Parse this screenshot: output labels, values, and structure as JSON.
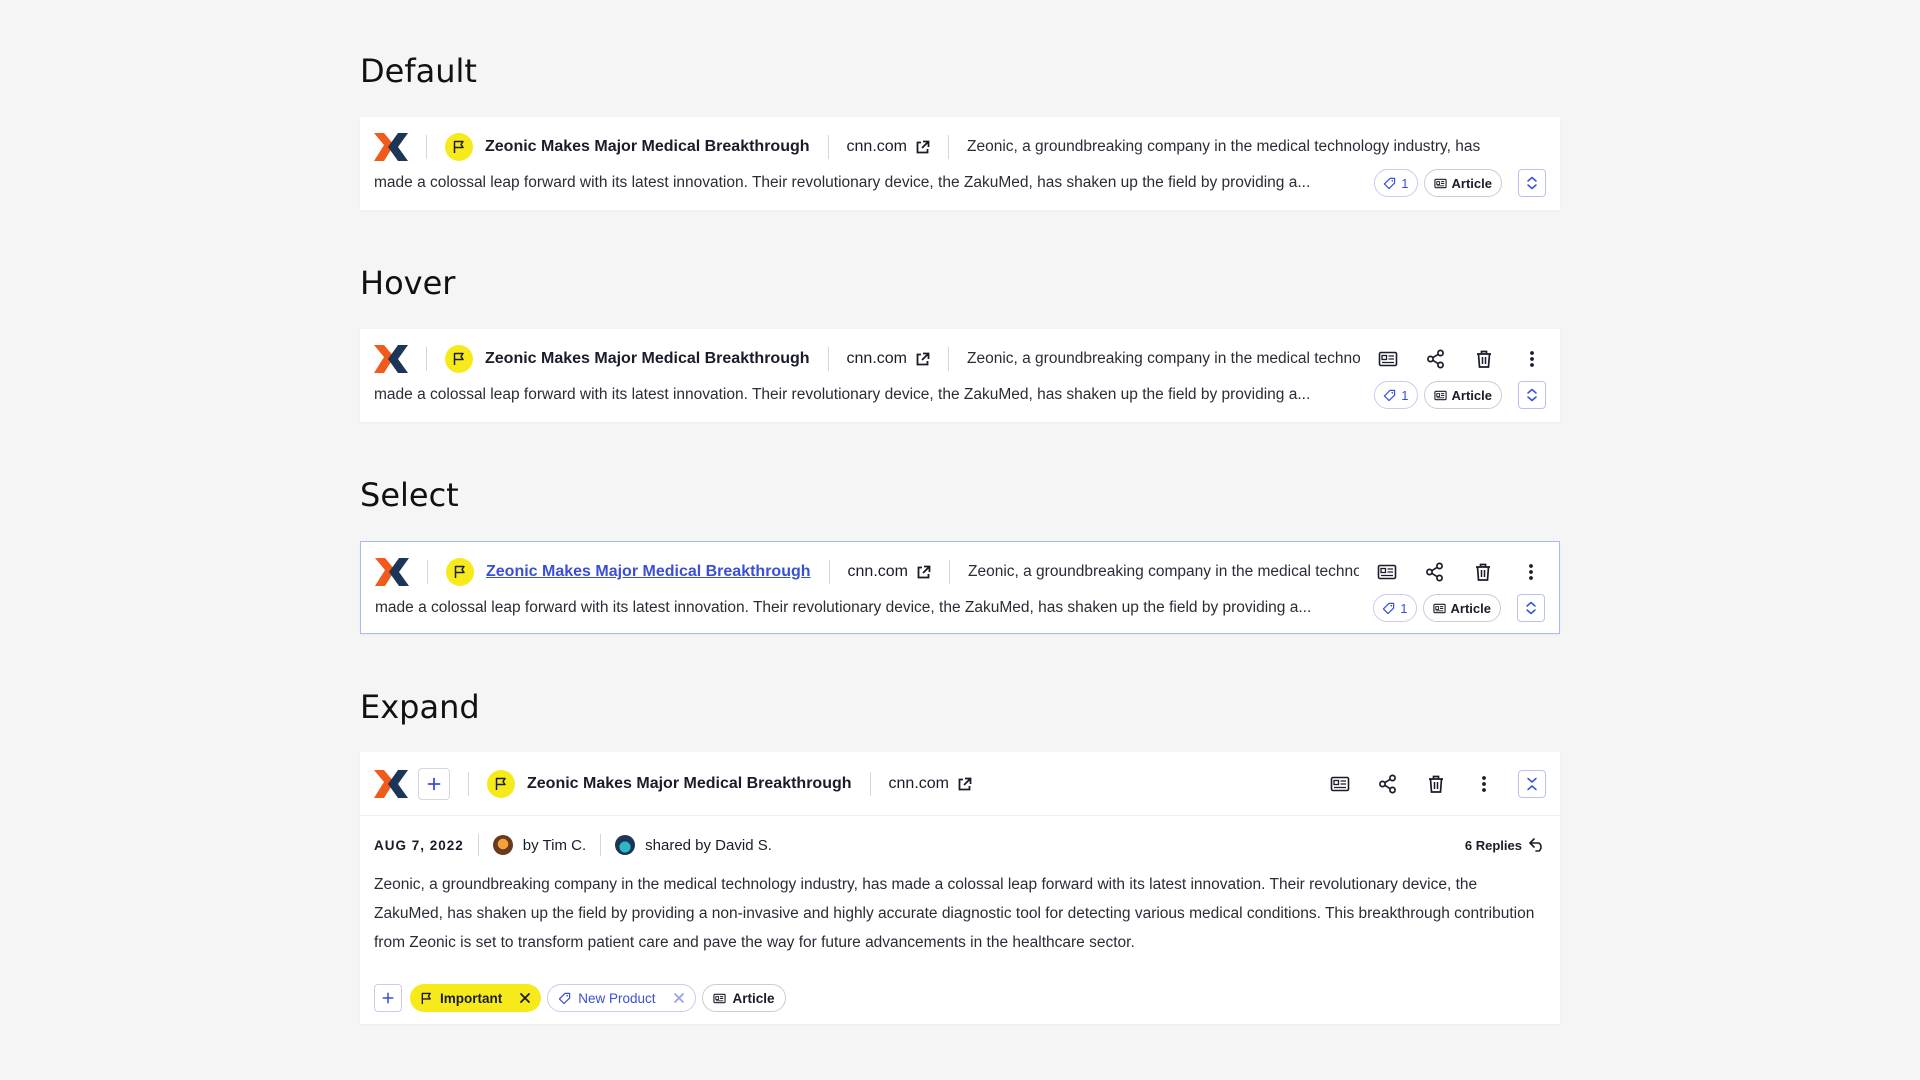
{
  "colors": {
    "accent": "#3a4fd8",
    "flag_yellow": "#f7ea1a",
    "logo_orange": "#f05a1a",
    "logo_navy": "#1d3557",
    "select_border": "#aab8f0"
  },
  "sections": {
    "default": "Default",
    "hover": "Hover",
    "select": "Select",
    "expand": "Expand"
  },
  "item": {
    "title": "Zeonic Makes Major Medical Breakthrough",
    "source": "cnn.com",
    "desc_line1": "Zeonic, a groundbreaking company in the medical technology industry, has",
    "desc_line2": "made a colossal leap forward with its latest innovation. Their revolutionary device, the ZakuMed, has shaken up the field by providing a...",
    "tag_count": "1",
    "type_label": "Article",
    "icons": [
      "company-logo",
      "flag-icon",
      "external-link-icon",
      "tag-icon",
      "article-icon",
      "expand-icon",
      "share-icon",
      "trash-icon",
      "more-icon"
    ]
  },
  "expanded": {
    "date": "AUG 7, 2022",
    "author": "by Tim C.",
    "shared_by": "shared by David S.",
    "replies": "6 Replies",
    "body": "Zeonic, a groundbreaking company in the medical technology industry, has made a colossal leap forward with its latest innovation. Their revolutionary device, the ZakuMed, has shaken up the field by providing a non-invasive and highly accurate diagnostic tool for detecting various medical conditions. This breakthrough contribution from Zeonic is set to transform patient care and pave the way for future advancements in the healthcare sector.",
    "tags": {
      "important": "Important",
      "new_product": "New Product",
      "article": "Article"
    }
  }
}
